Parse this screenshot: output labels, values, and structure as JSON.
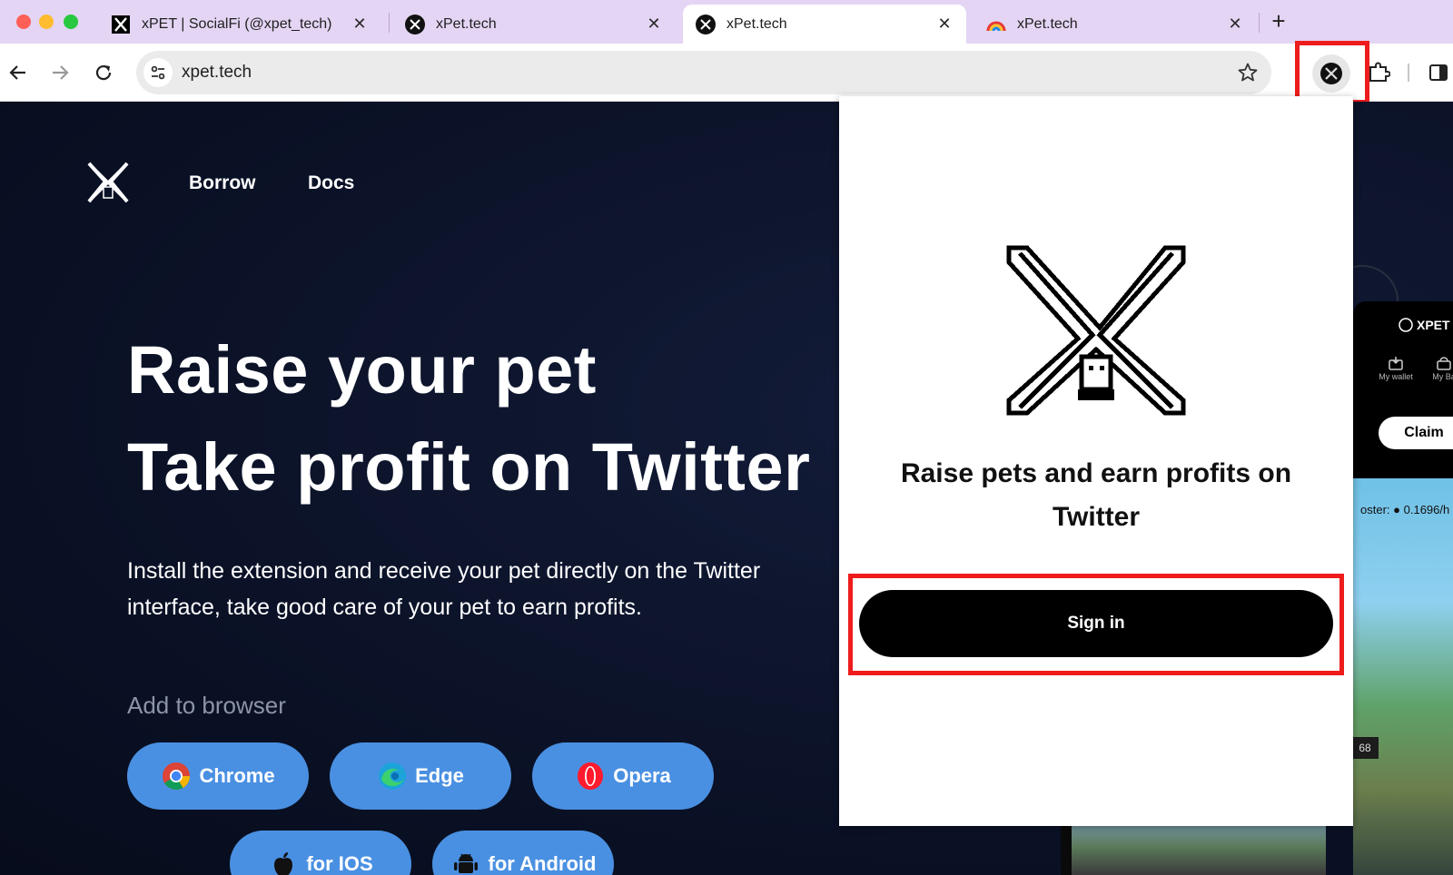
{
  "browser": {
    "tabs": [
      {
        "title": "xPET | SocialFi (@xpet_tech)",
        "favicon": "x-logo-icon",
        "active": false
      },
      {
        "title": "xPet.tech",
        "favicon": "xpet-icon",
        "active": false
      },
      {
        "title": "xPet.tech",
        "favicon": "xpet-icon",
        "active": true
      },
      {
        "title": "xPet.tech",
        "favicon": "rainbow-icon",
        "active": false
      }
    ],
    "close_glyph": "✕",
    "new_tab_glyph": "+",
    "url": "xpet.tech"
  },
  "site": {
    "nav": {
      "borrow": "Borrow",
      "docs": "Docs"
    },
    "hero_line1": "Raise your pet",
    "hero_line2": "Take profit on Twitter",
    "description": "Install the extension and receive your pet directly on the Twitter interface, take good care of your pet to earn profits.",
    "add_to_browser": "Add to browser",
    "stores": [
      {
        "label": "Chrome",
        "icon": "chrome-icon"
      },
      {
        "label": "Edge",
        "icon": "edge-icon"
      },
      {
        "label": "Opera",
        "icon": "opera-icon"
      },
      {
        "label": "for IOS",
        "icon": "apple-icon"
      },
      {
        "label": "for Android",
        "icon": "android-icon"
      }
    ]
  },
  "preview": {
    "brand": "XPET",
    "wallet": "My wallet",
    "bag": "My Ba",
    "claim": "Claim",
    "booster": "oster:",
    "rate": "0.1696/h",
    "counter": "68"
  },
  "popup": {
    "title": "Raise pets and earn profits on Twitter",
    "signin": "Sign in"
  },
  "colors": {
    "tabstrip": "#e4d5f4",
    "page_bg": "#0b1227",
    "store_button": "#4a90e2",
    "highlight": "#ee1c1c"
  }
}
